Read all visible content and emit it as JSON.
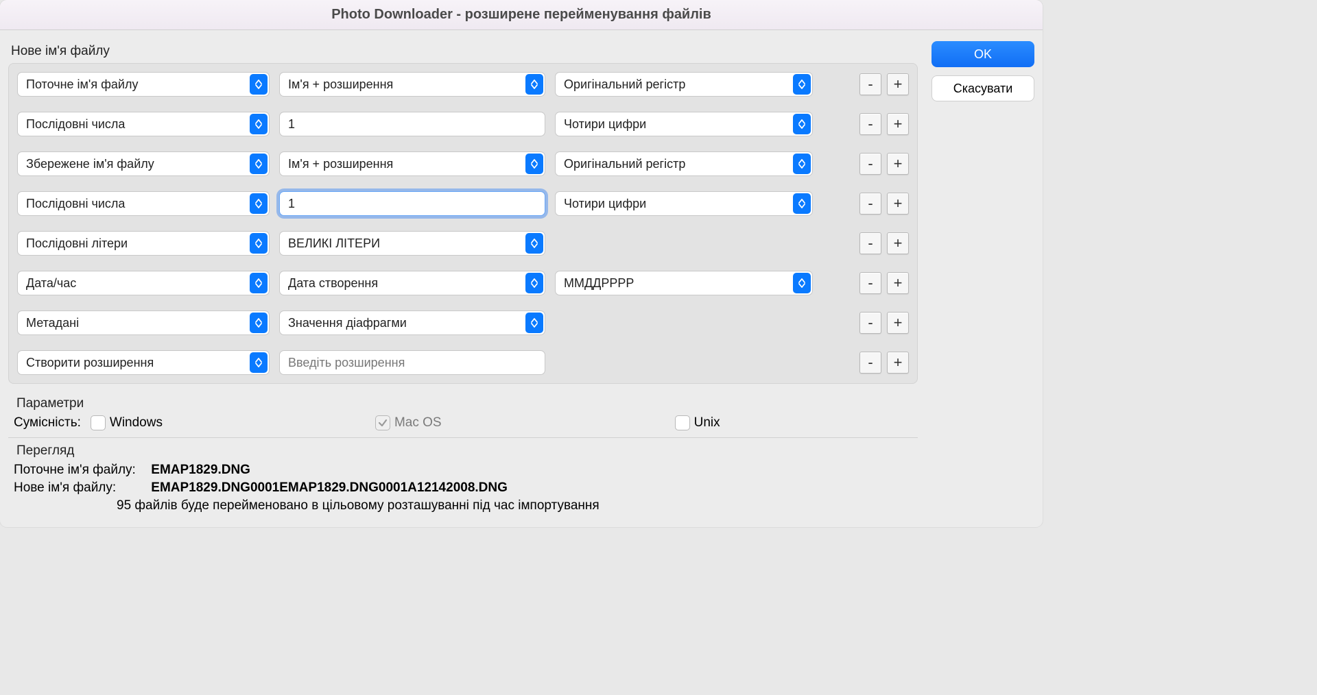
{
  "title": "Photo Downloader - розширене перейменування файлів",
  "sections": {
    "new_name_label": "Нове ім'я файлу",
    "params_label": "Параметри",
    "preview_label": "Перегляд"
  },
  "buttons": {
    "ok": "OK",
    "cancel": "Скасувати",
    "minus": "-",
    "plus": "+"
  },
  "rows": [
    {
      "c1": "Поточне ім'я файлу",
      "c2": "Ім'я + розширення",
      "c2type": "select",
      "c3": "Оригінальний регістр"
    },
    {
      "c1": "Послідовні числа",
      "c2": "1",
      "c2type": "input",
      "c3": "Чотири цифри"
    },
    {
      "c1": "Збережене ім'я файлу",
      "c2": "Ім'я + розширення",
      "c2type": "select",
      "c3": "Оригінальний регістр"
    },
    {
      "c1": "Послідовні числа",
      "c2": "1",
      "c2type": "input-focused",
      "c3": "Чотири цифри"
    },
    {
      "c1": "Послідовні літери",
      "c2": "ВЕЛИКІ ЛІТЕРИ",
      "c2type": "select",
      "c3": ""
    },
    {
      "c1": "Дата/час",
      "c2": "Дата створення",
      "c2type": "select",
      "c3": "ММДДРРРР"
    },
    {
      "c1": "Метадані",
      "c2": "Значення діафрагми",
      "c2type": "select",
      "c3": ""
    },
    {
      "c1": "Створити розширення",
      "c2": "Введіть розширення",
      "c2type": "input-placeholder",
      "c3": ""
    }
  ],
  "compat": {
    "label": "Сумісність:",
    "windows": "Windows",
    "macos": "Mac OS",
    "unix": "Unix"
  },
  "preview": {
    "current_label": "Поточне ім'я файлу:",
    "current_value": "EMAP1829.DNG",
    "new_label": "Нове ім'я файлу:",
    "new_value": "EMAP1829.DNG0001EMAP1829.DNG0001A12142008.DNG",
    "summary": "95 файлів буде перейменовано в цільовому розташуванні під час імпортування"
  }
}
